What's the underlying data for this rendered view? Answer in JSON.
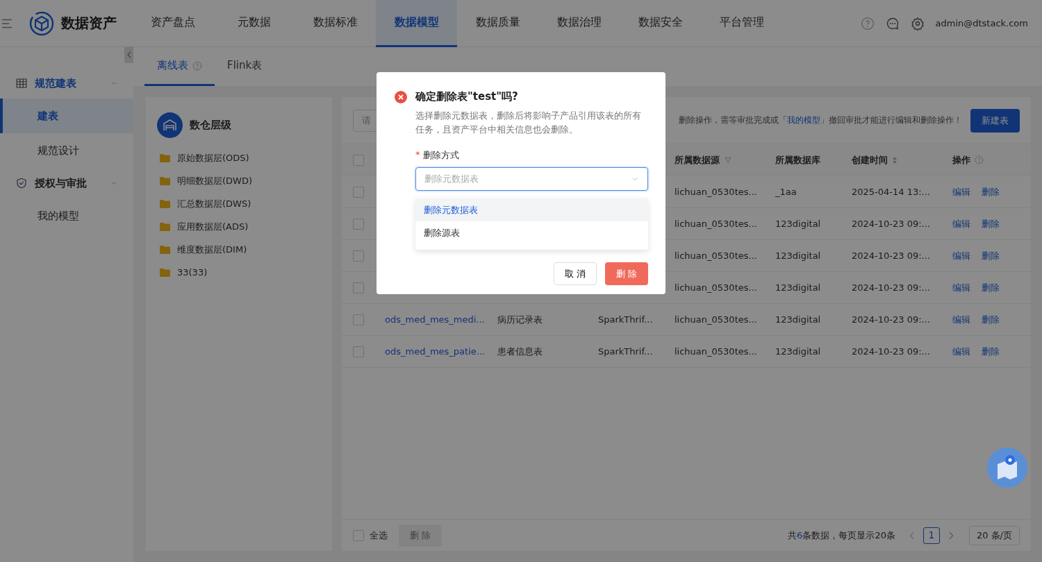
{
  "header": {
    "app_name": "数据资产",
    "nav": [
      {
        "label": "资产盘点",
        "selected": false
      },
      {
        "label": "元数据",
        "selected": false
      },
      {
        "label": "数据标准",
        "selected": false
      },
      {
        "label": "数据模型",
        "selected": true
      },
      {
        "label": "数据质量",
        "selected": false
      },
      {
        "label": "数据治理",
        "selected": false
      },
      {
        "label": "数据安全",
        "selected": false
      },
      {
        "label": "平台管理",
        "selected": false
      }
    ],
    "user": "admin@dtstack.com"
  },
  "sidebar": {
    "groups": [
      {
        "label": "规范建表",
        "expanded": true,
        "selected": true,
        "items": [
          {
            "label": "建表",
            "selected": true
          },
          {
            "label": "规范设计",
            "selected": false
          }
        ]
      },
      {
        "label": "授权与审批",
        "expanded": true,
        "selected": false,
        "items": [
          {
            "label": "我的模型",
            "selected": false
          }
        ]
      }
    ]
  },
  "tabs": [
    {
      "label": "离线表",
      "selected": true,
      "help": true
    },
    {
      "label": "Flink表",
      "selected": false,
      "help": false
    }
  ],
  "tree": {
    "title": "数仓层级",
    "items": [
      "原始数据层(ODS)",
      "明细数据层(DWD)",
      "汇总数据层(DWS)",
      "应用数据层(ADS)",
      "维度数据层(DIM)",
      "33(33)"
    ]
  },
  "toolbar": {
    "search_placeholder": "请",
    "notice": "删除操作，需等审批完成或「",
    "notice_link": "我的模型",
    "notice_end": "」撤回审批才能进行编辑和删除操作！",
    "new_button": "新建表"
  },
  "table": {
    "header_checked": false,
    "columns": [
      {
        "label": "所属数据源",
        "kind": "filter"
      },
      {
        "label": "所属数据库",
        "kind": "plain"
      },
      {
        "label": "创建时间",
        "kind": "sort"
      },
      {
        "label": "操作",
        "kind": "help"
      }
    ],
    "rows": [
      {
        "checked": false,
        "source": "lichuan_0530tes...",
        "database": "_1aa",
        "created": "2025-04-14 13:...",
        "edit": "编辑",
        "delete": "删除"
      },
      {
        "checked": false,
        "source": "lichuan_0530tes...",
        "database": "123digital",
        "created": "2024-10-23 09:...",
        "edit": "编辑",
        "delete": "删除"
      },
      {
        "checked": false,
        "source": "lichuan_0530tes...",
        "database": "123digital",
        "created": "2024-10-23 09:...",
        "edit": "编辑",
        "delete": "删除"
      },
      {
        "checked": false,
        "source": "lichuan_0530tes...",
        "database": "123digital",
        "created": "2024-10-23 09:...",
        "edit": "编辑",
        "delete": "删除"
      },
      {
        "checked": false,
        "name": "ods_med_mes_medi...",
        "description": "病历记录表",
        "type": "SparkThrif...",
        "source": "lichuan_0530tes...",
        "database": "123digital",
        "created": "2024-10-23 09:...",
        "edit": "编辑",
        "delete": "删除"
      },
      {
        "checked": false,
        "name": "ods_med_mes_patie...",
        "description": "患者信息表",
        "type": "SparkThrif...",
        "source": "lichuan_0530tes...",
        "database": "123digital",
        "created": "2024-10-23 09:...",
        "edit": "编辑",
        "delete": "删除"
      }
    ]
  },
  "footer": {
    "select_all": "全选",
    "select_all_checked": false,
    "delete_button": "删 除",
    "delete_disabled": true,
    "total_prefix": "共",
    "total_count": "6",
    "total_suffix": "条数据，每页显示20条",
    "page": "1",
    "page_size": "20 条/页"
  },
  "dialog": {
    "title": "确定删除表\"test\"吗?",
    "description": "选择删除元数据表，删除后将影响子产品引用该表的所有任务，且资产平台中相关信息也会删除。",
    "field_label": "删除方式",
    "required_mark": "*",
    "placeholder": "删除元数据表",
    "options": [
      {
        "label": "删除元数据表",
        "selected": true
      },
      {
        "label": "删除源表",
        "selected": false
      }
    ],
    "cancel": "取 消",
    "confirm": "删 除"
  }
}
